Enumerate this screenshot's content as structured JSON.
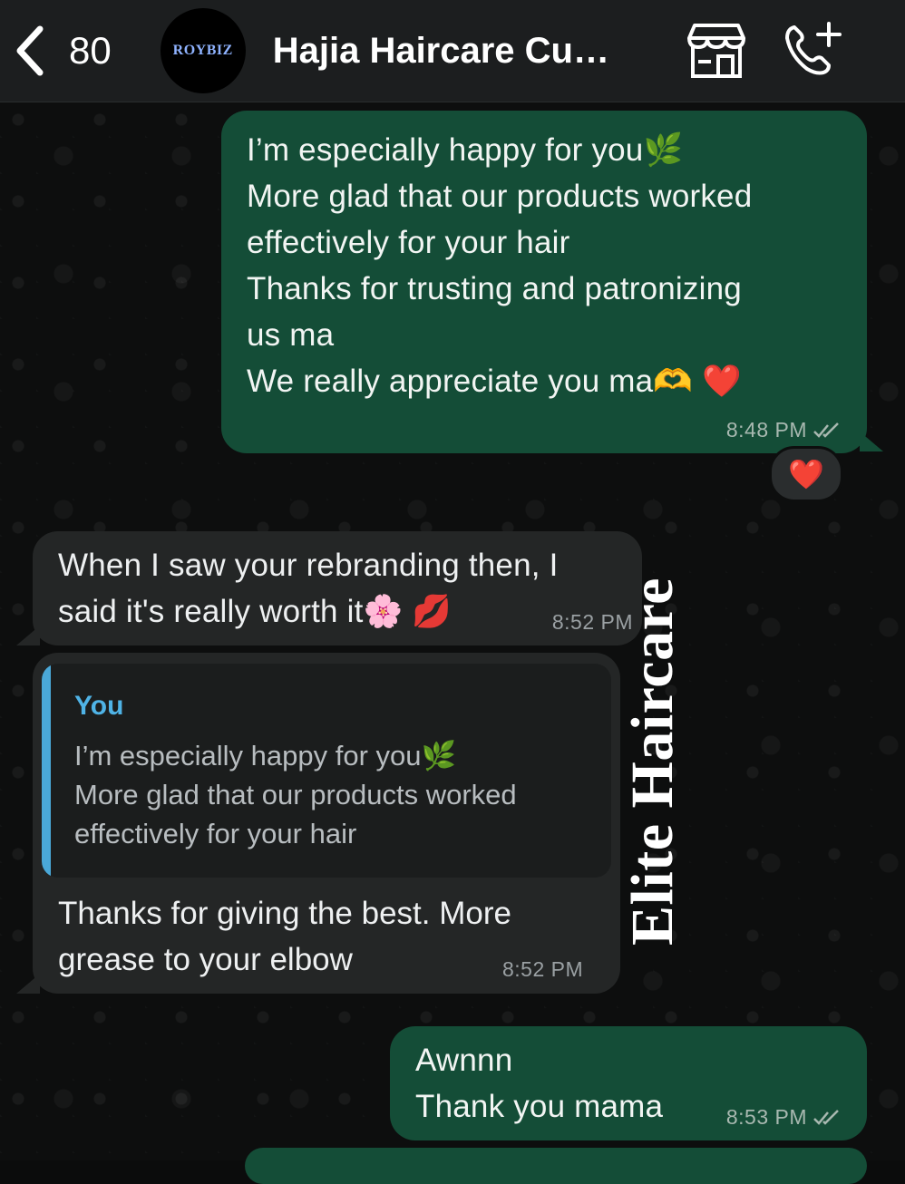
{
  "header": {
    "back_count": "80",
    "avatar_text": "ROYBIZ",
    "title": "Hajia Haircare Cu…"
  },
  "messages": [
    {
      "direction": "outgoing",
      "lines": [
        "I’m especially happy for you🌿",
        "More glad that our products worked",
        "effectively for your hair",
        "Thanks for trusting and patronizing",
        "us ma",
        "We really appreciate you ma🫶 ❤️"
      ],
      "time": "8:48 PM",
      "reaction": "❤️"
    },
    {
      "direction": "incoming",
      "lines": [
        "When I saw your rebranding then, I",
        "said it's really worth it🌸 💋"
      ],
      "time": "8:52 PM"
    },
    {
      "direction": "incoming",
      "quote": {
        "author": "You",
        "lines": [
          "I’m especially happy for you🌿",
          "More glad that our products worked",
          "effectively for your hair"
        ]
      },
      "lines": [
        "Thanks for giving the best. More",
        "grease to your elbow"
      ],
      "time": "8:52 PM"
    },
    {
      "direction": "outgoing",
      "lines": [
        "Awnnn",
        "Thank you mama"
      ],
      "time": "8:53 PM"
    }
  ],
  "watermark": "Elite Haircare",
  "colors": {
    "outgoing_bubble": "#144d37",
    "incoming_bubble": "#242626",
    "quote_accent": "#4aa8d8"
  }
}
